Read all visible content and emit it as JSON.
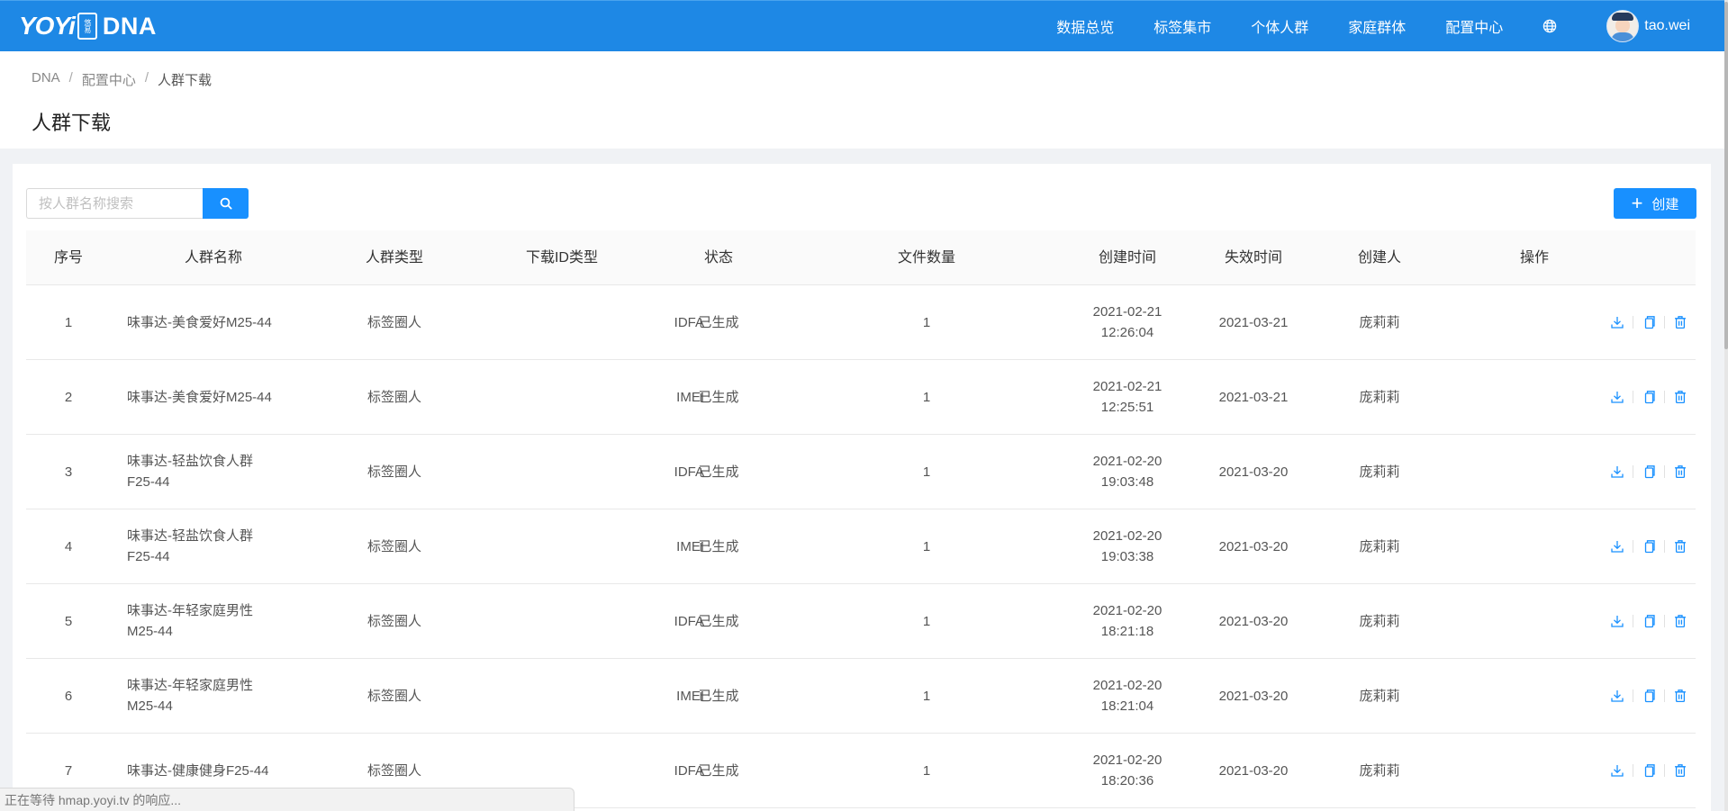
{
  "header": {
    "logo_text": "YOYi",
    "logo_badge": "悠易",
    "product_name": "DNA",
    "nav": [
      "数据总览",
      "标签集市",
      "个体人群",
      "家庭群体",
      "配置中心"
    ],
    "username": "tao.wei"
  },
  "breadcrumb": [
    "DNA",
    "配置中心",
    "人群下载"
  ],
  "page_title": "人群下载",
  "search": {
    "placeholder": "按人群名称搜索",
    "value": ""
  },
  "create_label": "创建",
  "table": {
    "columns": [
      "序号",
      "人群名称",
      "人群类型",
      "下载ID类型",
      "状态",
      "文件数量",
      "创建时间",
      "失效时间",
      "创建人",
      "操作"
    ],
    "rows": [
      {
        "index": "1",
        "name_line1": "味事达-美食爱好M25-44",
        "name_line2": "",
        "type": "标签圈人",
        "id_type": "IDFA",
        "status": "已生成",
        "files": "1",
        "created_date": "2021-02-21",
        "created_time": "12:26:04",
        "expire": "2021-03-21",
        "creator": "庞莉莉"
      },
      {
        "index": "2",
        "name_line1": "味事达-美食爱好M25-44",
        "name_line2": "",
        "type": "标签圈人",
        "id_type": "IMEI",
        "status": "已生成",
        "files": "1",
        "created_date": "2021-02-21",
        "created_time": "12:25:51",
        "expire": "2021-03-21",
        "creator": "庞莉莉"
      },
      {
        "index": "3",
        "name_line1": "味事达-轻盐饮食人群",
        "name_line2": "F25-44",
        "type": "标签圈人",
        "id_type": "IDFA",
        "status": "已生成",
        "files": "1",
        "created_date": "2021-02-20",
        "created_time": "19:03:48",
        "expire": "2021-03-20",
        "creator": "庞莉莉"
      },
      {
        "index": "4",
        "name_line1": "味事达-轻盐饮食人群",
        "name_line2": "F25-44",
        "type": "标签圈人",
        "id_type": "IMEI",
        "status": "已生成",
        "files": "1",
        "created_date": "2021-02-20",
        "created_time": "19:03:38",
        "expire": "2021-03-20",
        "creator": "庞莉莉"
      },
      {
        "index": "5",
        "name_line1": "味事达-年轻家庭男性",
        "name_line2": "M25-44",
        "type": "标签圈人",
        "id_type": "IDFA",
        "status": "已生成",
        "files": "1",
        "created_date": "2021-02-20",
        "created_time": "18:21:18",
        "expire": "2021-03-20",
        "creator": "庞莉莉"
      },
      {
        "index": "6",
        "name_line1": "味事达-年轻家庭男性",
        "name_line2": "M25-44",
        "type": "标签圈人",
        "id_type": "IMEI",
        "status": "已生成",
        "files": "1",
        "created_date": "2021-02-20",
        "created_time": "18:21:04",
        "expire": "2021-03-20",
        "creator": "庞莉莉"
      },
      {
        "index": "7",
        "name_line1": "味事达-健康健身F25-44",
        "name_line2": "",
        "type": "标签圈人",
        "id_type": "IDFA",
        "status": "已生成",
        "files": "1",
        "created_date": "2021-02-20",
        "created_time": "18:20:36",
        "expire": "2021-03-20",
        "creator": "庞莉莉"
      }
    ]
  },
  "status_bar": "正在等待 hmap.yoyi.tv 的响应...",
  "colors": {
    "header_bg": "#1e88e5",
    "primary": "#1890ff",
    "action_icon": "#1890ff"
  },
  "icons": {
    "search": "search-icon",
    "globe": "globe-icon",
    "download": "download-icon",
    "copy": "copy-icon",
    "delete": "delete-icon",
    "plus": "plus-icon"
  }
}
